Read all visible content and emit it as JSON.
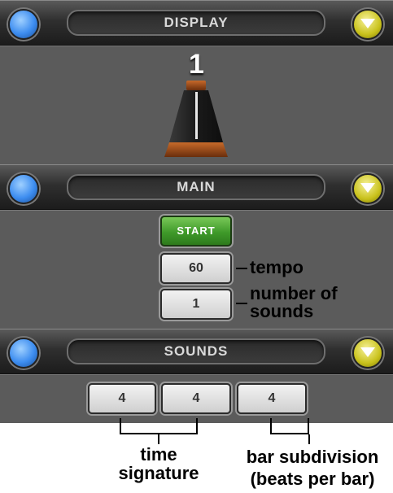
{
  "display": {
    "title": "DISPLAY",
    "beat": "1"
  },
  "main": {
    "title": "MAIN",
    "start_label": "START",
    "tempo_value": "60",
    "tempo_label": "tempo",
    "sounds_value": "1",
    "sounds_label_line1": "number of",
    "sounds_label_line2": "sounds"
  },
  "sounds": {
    "title": "SOUNDS",
    "values": [
      "4",
      "4",
      "4"
    ]
  },
  "annotations": {
    "time_signature_line1": "time",
    "time_signature_line2": "signature",
    "bar_subdivision_line1": "bar subdivision",
    "bar_subdivision_line2": "(beats per bar)"
  },
  "colors": {
    "blue": "#3d8df0",
    "yellow": "#c9c21c",
    "green": "#3f9a2a"
  },
  "icons": [
    "blue-circle-icon",
    "yellow-chevron-down-icon",
    "metronome-icon"
  ]
}
